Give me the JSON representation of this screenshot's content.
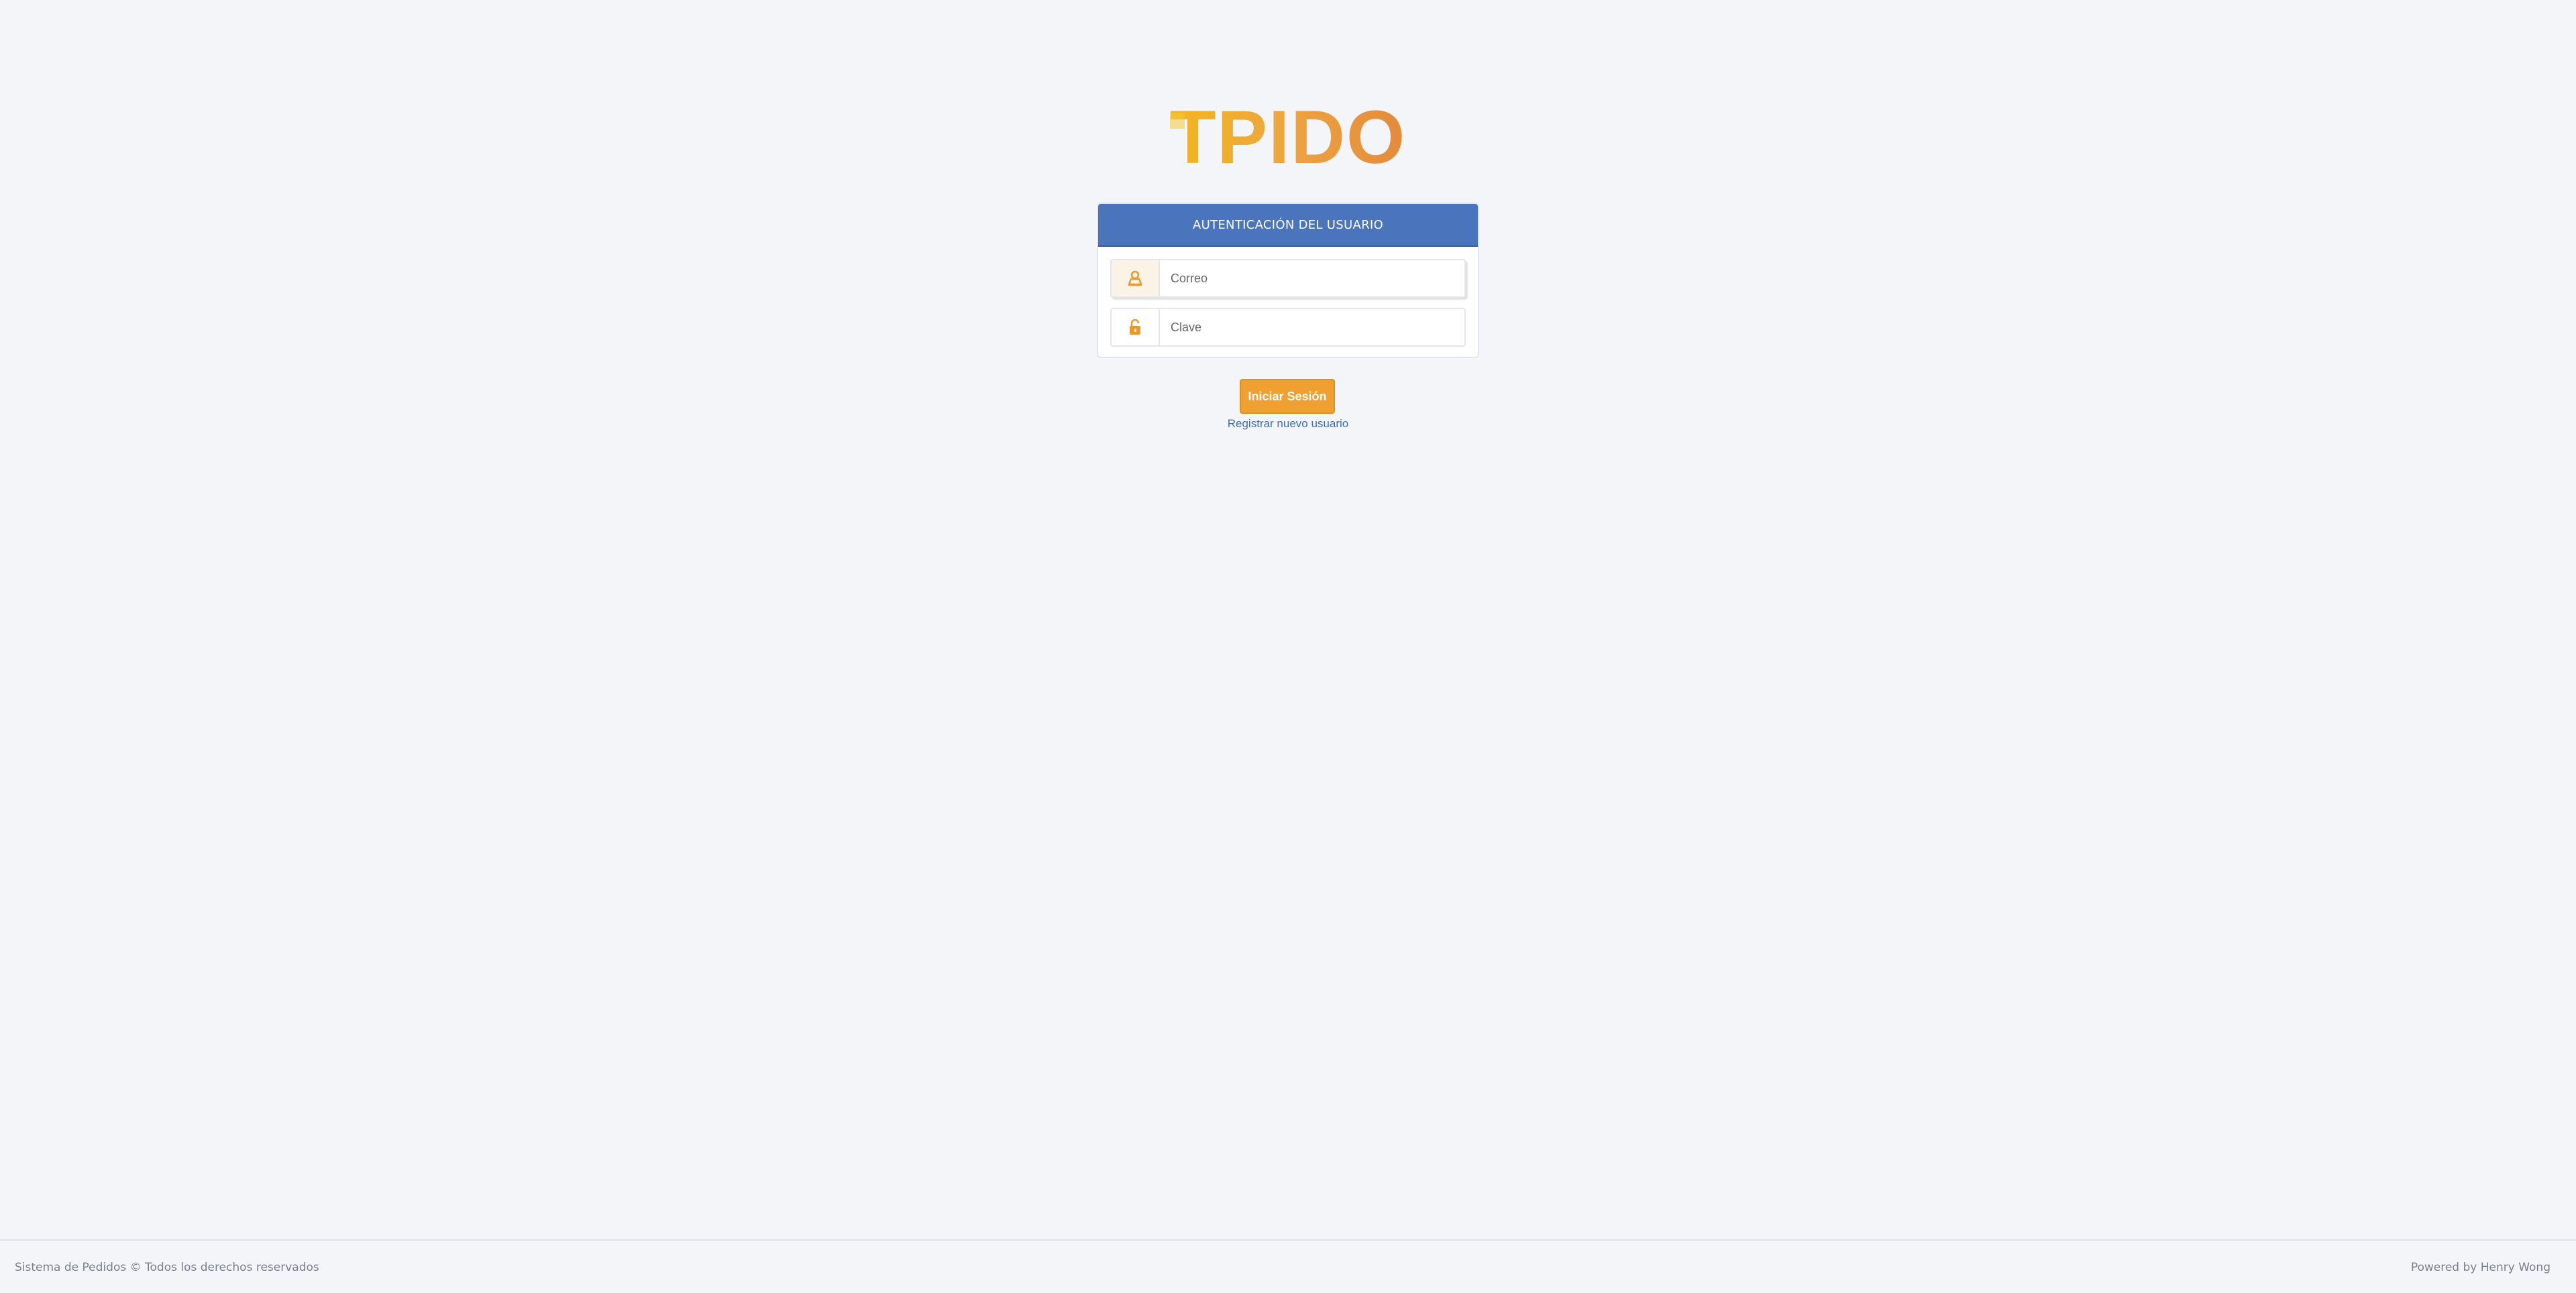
{
  "logo": {
    "text": "TPIDO",
    "colors": [
      "#f2b61f",
      "#eda540",
      "#e38a3c"
    ]
  },
  "login_panel": {
    "title": "AUTENTICACIÓN DEL USUARIO",
    "header_color": "#4a75bd",
    "email": {
      "placeholder": "Correo",
      "value": "",
      "icon": "user-icon"
    },
    "password": {
      "placeholder": "Clave",
      "value": "",
      "icon": "unlock-icon"
    }
  },
  "actions": {
    "login_label": "Iniciar Sesión",
    "login_color": "#f0a030",
    "register_label": "Registrar nuevo usuario"
  },
  "footer": {
    "left_text": "Sistema de Pedidos © Todos los derechos reservados",
    "right_text": "Powered by Henry Wong"
  }
}
